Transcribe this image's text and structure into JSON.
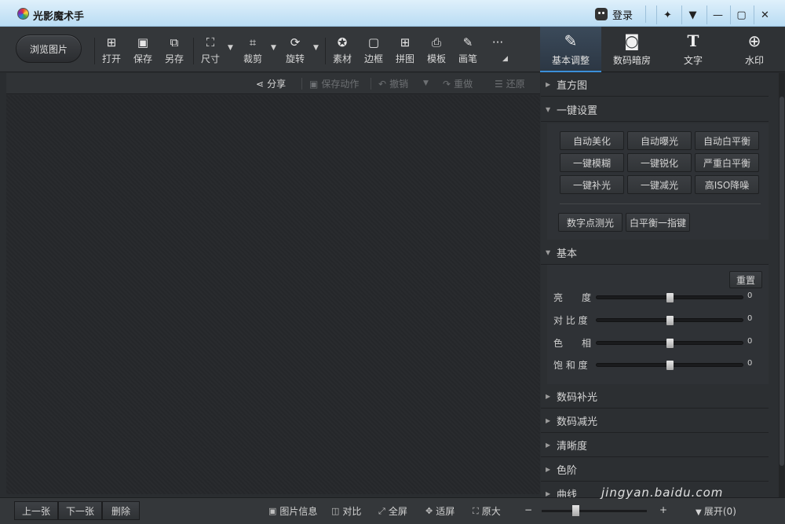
{
  "app": {
    "title": "光影魔术手"
  },
  "titlebar": {
    "login_label": "登录"
  },
  "toolbar": {
    "browse_label": "浏览图片",
    "tools": [
      {
        "label": "打开",
        "icon": "open-icon"
      },
      {
        "label": "保存",
        "icon": "save-icon"
      },
      {
        "label": "另存",
        "icon": "save-as-icon"
      },
      {
        "label": "尺寸",
        "icon": "resize-icon"
      },
      {
        "label": "裁剪",
        "icon": "crop-icon"
      },
      {
        "label": "旋转",
        "icon": "rotate-icon"
      },
      {
        "label": "素材",
        "icon": "sticker-icon"
      },
      {
        "label": "边框",
        "icon": "frame-icon"
      },
      {
        "label": "拼图",
        "icon": "collage-icon"
      },
      {
        "label": "模板",
        "icon": "template-icon"
      },
      {
        "label": "画笔",
        "icon": "brush-icon"
      }
    ]
  },
  "modes": [
    {
      "label": "基本调整",
      "icon": "adjust-icon",
      "active": true
    },
    {
      "label": "数码暗房",
      "icon": "camera-icon",
      "active": false
    },
    {
      "label": "文字",
      "icon": "text-icon",
      "active": false
    },
    {
      "label": "水印",
      "icon": "watermark-icon",
      "active": false
    }
  ],
  "subbar": {
    "share": "分享",
    "save_action": "保存动作",
    "undo": "撤销",
    "redo": "重做",
    "restore": "还原"
  },
  "panel": {
    "histogram": "直方图",
    "one_click": "一键设置",
    "quick_buttons": [
      "自动美化",
      "自动曝光",
      "自动白平衡",
      "一键模糊",
      "一键锐化",
      "严重白平衡",
      "一键补光",
      "一键减光",
      "高ISO降噪"
    ],
    "extra_buttons": [
      "数字点测光",
      "白平衡一指键"
    ],
    "basic": "基本",
    "reset": "重置",
    "sliders": [
      {
        "label": "亮　　度",
        "value": "0",
        "position": 0.5
      },
      {
        "label": "对 比 度",
        "value": "0",
        "position": 0.5
      },
      {
        "label": "色　　相",
        "value": "0",
        "position": 0.5
      },
      {
        "label": "饱 和 度",
        "value": "0",
        "position": 0.5
      }
    ],
    "sections": [
      "数码补光",
      "数码减光",
      "清晰度",
      "色阶",
      "曲线"
    ]
  },
  "bottombar": {
    "prev": "上一张",
    "next": "下一张",
    "delete": "删除",
    "info": "图片信息",
    "compare": "对比",
    "fullscreen": "全屏",
    "fit": "适屏",
    "original": "原大",
    "zoom_minus": "−",
    "zoom_plus": "+",
    "expand": "展开(0)"
  },
  "watermark_text": "jingyan.baidu.com"
}
